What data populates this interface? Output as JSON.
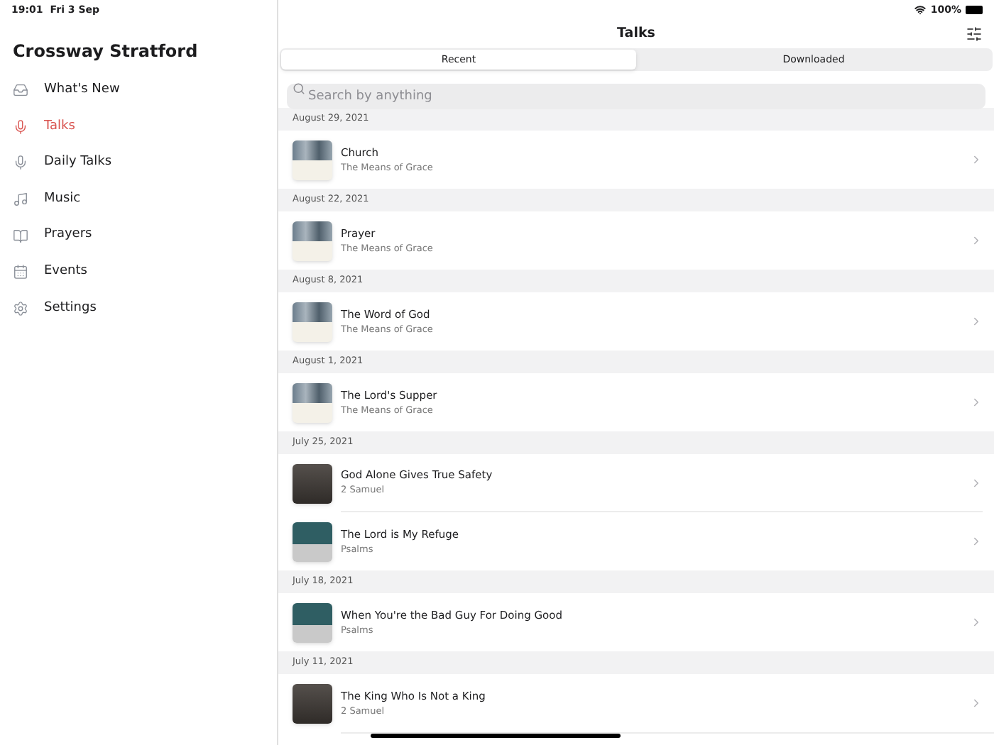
{
  "status_bar": {
    "time": "19:01",
    "date": "Fri 3 Sep",
    "battery": "100%"
  },
  "sidebar": {
    "title": "Crossway Stratford",
    "items": [
      {
        "kind": "tray",
        "label": "What's New",
        "selected": false
      },
      {
        "kind": "mic",
        "label": "Talks",
        "selected": true
      },
      {
        "kind": "mic",
        "label": "Daily Talks",
        "selected": false
      },
      {
        "kind": "music",
        "label": "Music",
        "selected": false
      },
      {
        "kind": "book",
        "label": "Prayers",
        "selected": false
      },
      {
        "kind": "calendar",
        "label": "Events",
        "selected": false
      },
      {
        "kind": "gear",
        "label": "Settings",
        "selected": false
      }
    ]
  },
  "header": {
    "title": "Talks"
  },
  "tabs": [
    {
      "label": "Recent",
      "selected": true
    },
    {
      "label": "Downloaded",
      "selected": false
    }
  ],
  "search": {
    "placeholder": "Search by anything"
  },
  "sections": [
    {
      "date": "August 29, 2021",
      "talks": [
        {
          "title": "Church",
          "series": "The Means of Grace",
          "kind": "people"
        }
      ]
    },
    {
      "date": "August 22, 2021",
      "talks": [
        {
          "title": "Prayer",
          "series": "The Means of Grace",
          "kind": "people"
        }
      ]
    },
    {
      "date": "August 8, 2021",
      "talks": [
        {
          "title": "The Word of God",
          "series": "The Means of Grace",
          "kind": "people"
        }
      ]
    },
    {
      "date": "August 1, 2021",
      "talks": [
        {
          "title": "The Lord's Supper",
          "series": "The Means of Grace",
          "kind": "people"
        }
      ]
    },
    {
      "date": "July 25, 2021",
      "talks": [
        {
          "title": "God Alone Gives True Safety",
          "series": "2 Samuel",
          "kind": "mountain"
        },
        {
          "title": "The Lord is My Refuge",
          "series": "Psalms",
          "kind": "book"
        }
      ]
    },
    {
      "date": "July 18, 2021",
      "talks": [
        {
          "title": "When You're the Bad Guy For Doing Good",
          "series": "Psalms",
          "kind": "book"
        }
      ]
    },
    {
      "date": "July 11, 2021",
      "talks": [
        {
          "title": "The King Who Is Not a King",
          "series": "2 Samuel",
          "kind": "mountain"
        }
      ]
    }
  ]
}
